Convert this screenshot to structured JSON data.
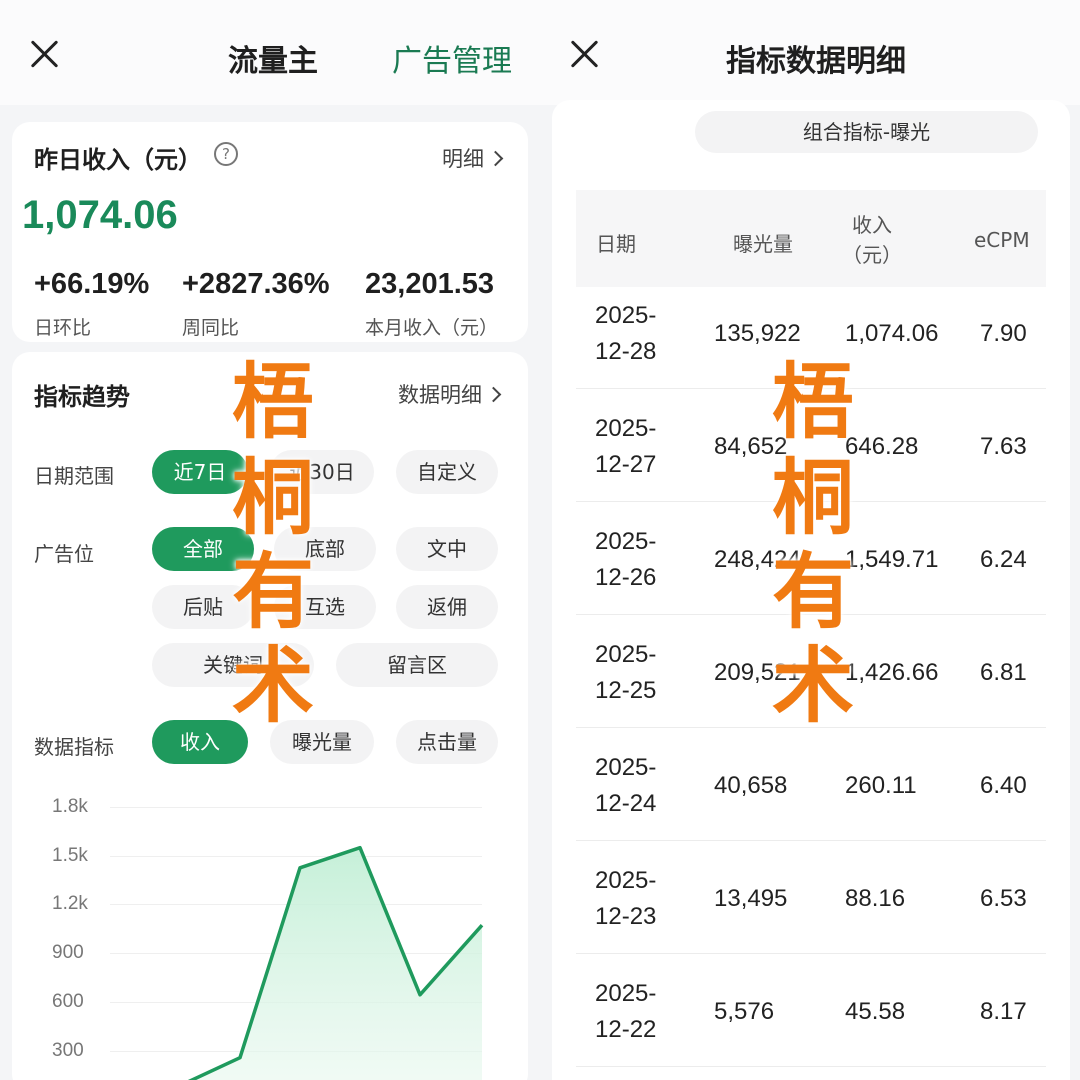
{
  "left": {
    "header": {
      "title": "流量主",
      "link": "广告管理"
    },
    "income": {
      "title": "昨日收入（元）",
      "help": "?",
      "detail": "明细",
      "value": "1,074.06",
      "stats": [
        {
          "value": "+66.19%",
          "label": "日环比"
        },
        {
          "value": "+2827.36%",
          "label": "周同比"
        },
        {
          "value": "23,201.53",
          "label": "本月收入（元）"
        }
      ]
    },
    "trend": {
      "title": "指标趋势",
      "detail": "数据明细",
      "date_range": {
        "label": "日期范围",
        "options": [
          "近7日",
          "近30日",
          "自定义"
        ],
        "selected": "近7日"
      },
      "ad_slot": {
        "label": "广告位",
        "options": [
          "全部",
          "底部",
          "文中",
          "后贴",
          "互选",
          "返佣",
          "关键词",
          "留言区"
        ],
        "selected": "全部"
      },
      "metric": {
        "label": "数据指标",
        "options": [
          "收入",
          "曝光量",
          "点击量"
        ],
        "selected": "收入"
      }
    }
  },
  "chart_data": {
    "type": "area",
    "y_ticks": [
      "1.8k",
      "1.5k",
      "1.2k",
      "900",
      "600",
      "300"
    ],
    "ylim": [
      0,
      1800
    ],
    "values": [
      45.58,
      88.16,
      260.11,
      1426.66,
      1549.71,
      646.28,
      1074.06
    ],
    "color": "#1f9a5d"
  },
  "right": {
    "header": {
      "title": "指标数据明细"
    },
    "combo": "组合指标-曝光",
    "columns": [
      "日期",
      "曝光量",
      "收入\n（元）",
      "eCPM"
    ],
    "rows": [
      {
        "date1": "2025-",
        "date2": "12-28",
        "exposure": "135,922",
        "income": "1,074.06",
        "ecpm": "7.90"
      },
      {
        "date1": "2025-",
        "date2": "12-27",
        "exposure": "84,652",
        "income": "646.28",
        "ecpm": "7.63"
      },
      {
        "date1": "2025-",
        "date2": "12-26",
        "exposure": "248,424",
        "income": "1,549.71",
        "ecpm": "6.24"
      },
      {
        "date1": "2025-",
        "date2": "12-25",
        "exposure": "209,521",
        "income": "1,426.66",
        "ecpm": "6.81"
      },
      {
        "date1": "2025-",
        "date2": "12-24",
        "exposure": "40,658",
        "income": "260.11",
        "ecpm": "6.40"
      },
      {
        "date1": "2025-",
        "date2": "12-23",
        "exposure": "13,495",
        "income": "88.16",
        "ecpm": "6.53"
      },
      {
        "date1": "2025-",
        "date2": "12-22",
        "exposure": "5,576",
        "income": "45.58",
        "ecpm": "8.17"
      }
    ]
  },
  "watermark": [
    "梧",
    "桐",
    "有",
    "术"
  ],
  "colors": {
    "accent": "#1f9a5d",
    "watermark": "#f07a12"
  }
}
